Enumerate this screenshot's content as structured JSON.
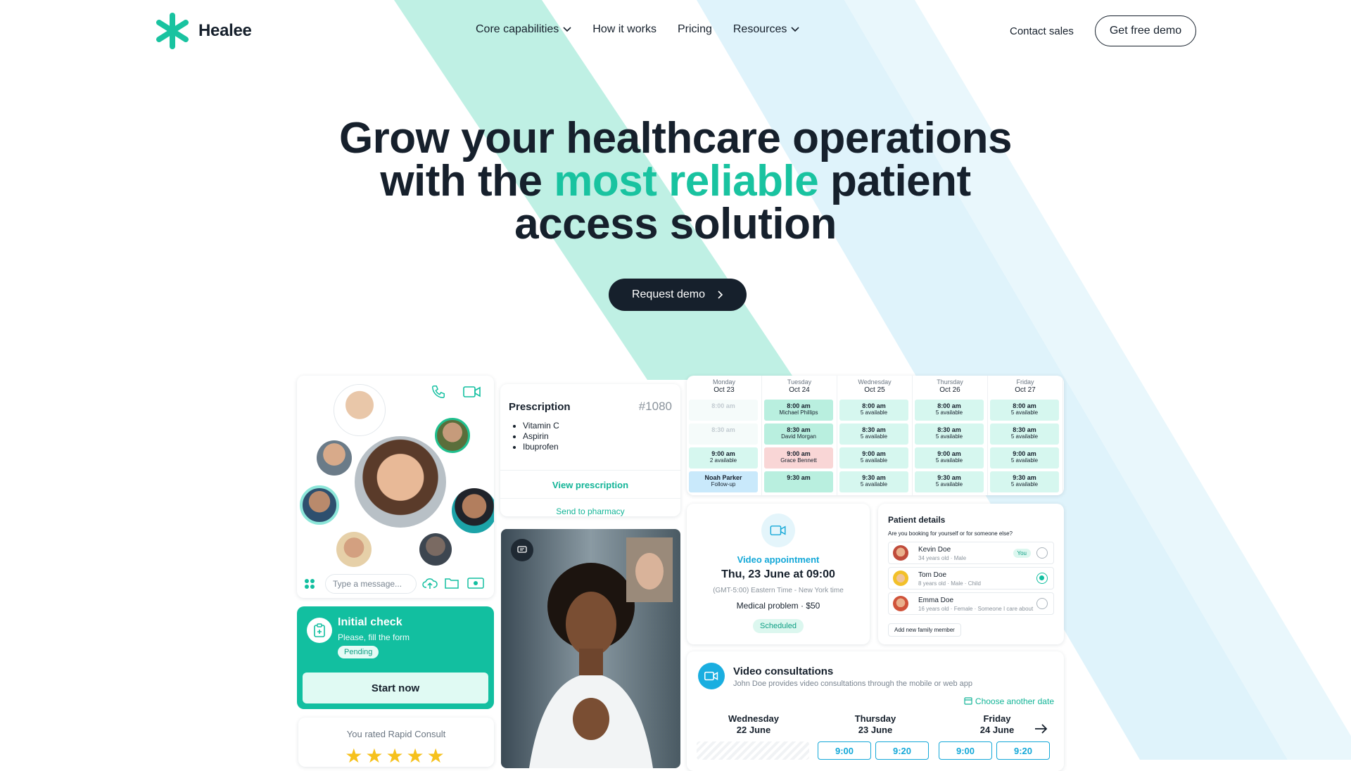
{
  "brand": {
    "name": "Healee",
    "accent_color": "#19c3a0",
    "dark_color": "#16202c"
  },
  "nav": {
    "items": [
      {
        "label": "Core capabilities",
        "has_dropdown": true
      },
      {
        "label": "How it works",
        "has_dropdown": false
      },
      {
        "label": "Pricing",
        "has_dropdown": false
      },
      {
        "label": "Resources",
        "has_dropdown": true
      }
    ],
    "contact_label": "Contact sales",
    "demo_label": "Get free demo"
  },
  "hero": {
    "line1": "Grow your healthcare operations",
    "line2_start": "with the ",
    "line2_accent": "most reliable",
    "line2_end": " patient",
    "line3": "access solution",
    "cta_label": "Request demo"
  },
  "chat": {
    "input_placeholder": "Type a message..."
  },
  "initial_check": {
    "title": "Initial check",
    "subtitle": "Please, fill the form",
    "status": "Pending",
    "button": "Start now"
  },
  "rating": {
    "text": "You rated Rapid Consult",
    "stars": 5
  },
  "prescription": {
    "title": "Prescription",
    "number": "#1080",
    "items": [
      "Vitamin C",
      "Aspirin",
      "Ibuprofen"
    ],
    "view_label": "View prescription",
    "send_label": "Send to pharmacy"
  },
  "calendar": {
    "days": [
      {
        "name": "Monday",
        "date": "Oct 23",
        "slots": [
          {
            "time": "8:00 am",
            "sub": "",
            "style": "faded"
          },
          {
            "time": "8:30 am",
            "sub": "",
            "style": "faded"
          },
          {
            "time": "9:00 am",
            "sub": "2 available",
            "style": "open"
          },
          {
            "time": "Noah Parker",
            "sub": "Follow-up",
            "style": "blue"
          }
        ]
      },
      {
        "name": "Tuesday",
        "date": "Oct 24",
        "slots": [
          {
            "time": "8:00 am",
            "sub": "Michael Phillips",
            "style": "booked"
          },
          {
            "time": "8:30 am",
            "sub": "David Morgan",
            "style": "booked"
          },
          {
            "time": "9:00 am",
            "sub": "Grace Bennett",
            "style": "pink"
          },
          {
            "time": "9:30 am",
            "sub": "",
            "style": "booked"
          }
        ]
      },
      {
        "name": "Wednesday",
        "date": "Oct 25",
        "slots": [
          {
            "time": "8:00 am",
            "sub": "5 available",
            "style": "open"
          },
          {
            "time": "8:30 am",
            "sub": "5 available",
            "style": "open"
          },
          {
            "time": "9:00 am",
            "sub": "5 available",
            "style": "open"
          },
          {
            "time": "9:30 am",
            "sub": "5 available",
            "style": "open"
          }
        ]
      },
      {
        "name": "Thursday",
        "date": "Oct 26",
        "slots": [
          {
            "time": "8:00 am",
            "sub": "5 available",
            "style": "open"
          },
          {
            "time": "8:30 am",
            "sub": "5 available",
            "style": "open"
          },
          {
            "time": "9:00 am",
            "sub": "5 available",
            "style": "open"
          },
          {
            "time": "9:30 am",
            "sub": "5 available",
            "style": "open"
          }
        ]
      },
      {
        "name": "Friday",
        "date": "Oct 27",
        "slots": [
          {
            "time": "8:00 am",
            "sub": "5 available",
            "style": "open"
          },
          {
            "time": "8:30 am",
            "sub": "5 available",
            "style": "open"
          },
          {
            "time": "9:00 am",
            "sub": "5 available",
            "style": "open"
          },
          {
            "time": "9:30 am",
            "sub": "5 available",
            "style": "open"
          }
        ]
      }
    ]
  },
  "video_appointment": {
    "label": "Video appointment",
    "datetime": "Thu, 23 June at 09:00",
    "timezone": "(GMT-5:00) Eastern Time - New York time",
    "detail": "Medical problem · $50",
    "status": "Scheduled"
  },
  "patient_details": {
    "title": "Patient details",
    "question": "Are you booking for yourself or for someone else?",
    "patients": [
      {
        "name": "Kevin Doe",
        "desc": "34 years old · Male",
        "tag": "You",
        "selected": false
      },
      {
        "name": "Tom Doe",
        "desc": "8 years old · Male · Child",
        "tag": "",
        "selected": true
      },
      {
        "name": "Emma Doe",
        "desc": "16 years old · Female · Someone I care about",
        "tag": "",
        "selected": false
      }
    ],
    "add_label": "Add new family member"
  },
  "video_consultations": {
    "title": "Video consultations",
    "subtitle": "John Doe provides video consultations through the mobile or web app",
    "choose_label": "Choose another date",
    "days": [
      {
        "name": "Wednesday",
        "date": "22 June"
      },
      {
        "name": "Thursday",
        "date": "23 June"
      },
      {
        "name": "Friday",
        "date": "24 June"
      }
    ],
    "times": [
      "9:00",
      "9:20",
      "9:00",
      "9:20"
    ]
  }
}
